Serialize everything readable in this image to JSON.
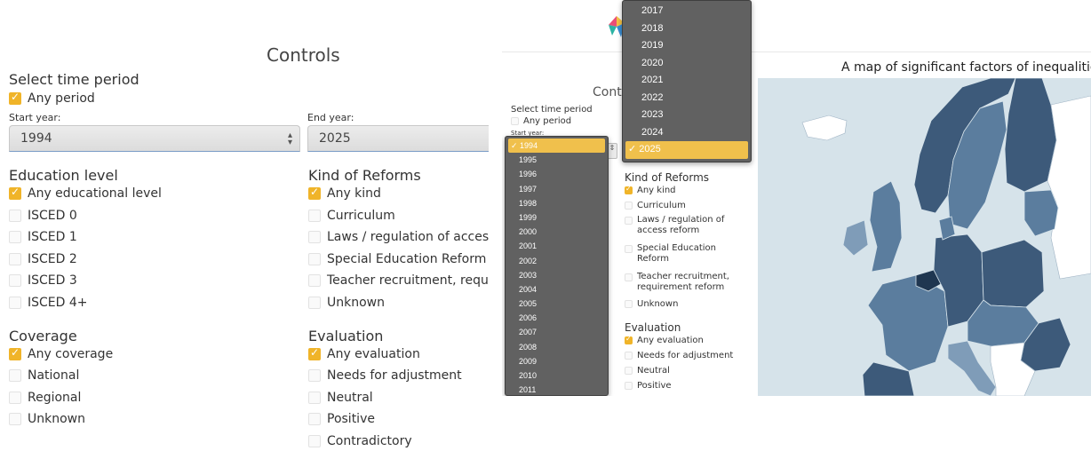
{
  "left": {
    "title": "Controls",
    "time": {
      "heading": "Select time period",
      "any_label": "Any period",
      "start_label": "Start year:",
      "start_value": "1994",
      "end_label": "End year:",
      "end_value": "2025"
    },
    "education": {
      "heading": "Education level",
      "options": [
        "Any educational level",
        "ISCED 0",
        "ISCED 1",
        "ISCED 2",
        "ISCED 3",
        "ISCED 4+"
      ]
    },
    "reforms": {
      "heading": "Kind of Reforms",
      "options": [
        "Any kind",
        "Curriculum",
        "Laws / regulation of access",
        "Special Education Reform",
        "Teacher recruitment, requ",
        "Unknown"
      ]
    },
    "coverage": {
      "heading": "Coverage",
      "options": [
        "Any coverage",
        "National",
        "Regional",
        "Unknown"
      ]
    },
    "evaluation": {
      "heading": "Evaluation",
      "options": [
        "Any evaluation",
        "Needs for adjustment",
        "Neutral",
        "Positive",
        "Contradictory"
      ]
    }
  },
  "right": {
    "map_title": "A map of significant factors of inequalities i",
    "controls_title_partial": "Cont",
    "time_heading": "Select time period",
    "any_period": "Any period",
    "start_label_partial": "Start year:",
    "start_years": [
      "1994",
      "1995",
      "1996",
      "1997",
      "1998",
      "1999",
      "2000",
      "2001",
      "2002",
      "2003",
      "2004",
      "2005",
      "2006",
      "2007",
      "2008",
      "2009",
      "2010",
      "2011"
    ],
    "start_selected": "1994",
    "end_years": [
      "2017",
      "2018",
      "2019",
      "2020",
      "2021",
      "2022",
      "2023",
      "2024",
      "2025"
    ],
    "end_selected": "2025",
    "reforms_heading": "Kind of Reforms",
    "reforms_options": [
      "Any kind",
      "Curriculum",
      "Laws / regulation of access reform",
      "Special Education Reform",
      "Teacher recruitment, requirement reform",
      "Unknown"
    ],
    "evaluation_heading": "Evaluation",
    "evaluation_options": [
      "Any evaluation",
      "Needs for adjustment",
      "Neutral",
      "Positive"
    ],
    "colors": {
      "accent": "#f0b429",
      "sea": "#d6e3ea",
      "land_nonmember": "#ffffff",
      "map_dark": "#3d5a7a",
      "map_mid": "#5b7d9e",
      "map_light": "#7f9cb8",
      "map_darkest": "#1f3650"
    }
  }
}
